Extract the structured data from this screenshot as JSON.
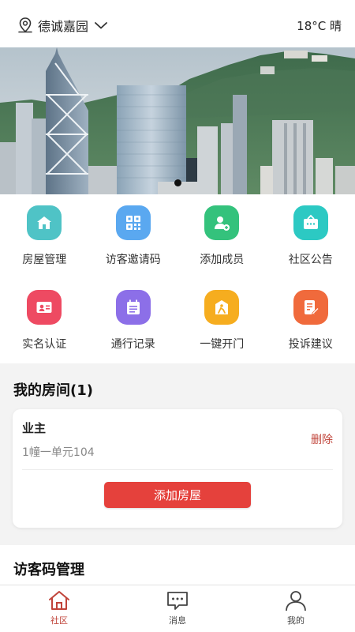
{
  "header": {
    "location": "德诚嘉园",
    "weather": "18°C 晴"
  },
  "banner": {
    "slides": 1,
    "active_slide": 1
  },
  "quick_actions": [
    {
      "label": "房屋管理",
      "icon": "house-icon",
      "color": "#4fc3c6"
    },
    {
      "label": "访客邀请码",
      "icon": "qr-code-icon",
      "color": "#5aa8f0"
    },
    {
      "label": "添加成员",
      "icon": "add-member-icon",
      "color": "#34c27c"
    },
    {
      "label": "社区公告",
      "icon": "notice-icon",
      "color": "#2cc9c3"
    },
    {
      "label": "实名认证",
      "icon": "id-card-icon",
      "color": "#ee4a62"
    },
    {
      "label": "通行记录",
      "icon": "calendar-list-icon",
      "color": "#8c6fe8"
    },
    {
      "label": "一键开门",
      "icon": "door-open-icon",
      "color": "#f6ad1f"
    },
    {
      "label": "投诉建议",
      "icon": "edit-note-icon",
      "color": "#f06a3c"
    }
  ],
  "my_rooms": {
    "title": "我的房间(1)",
    "room": {
      "role": "业主",
      "address": "1幢一单元104",
      "delete_label": "删除"
    },
    "add_button": "添加房屋"
  },
  "visitor_code": {
    "title": "访客码管理"
  },
  "tabbar": [
    {
      "label": "社区",
      "icon": "home-icon",
      "active": true
    },
    {
      "label": "消息",
      "icon": "message-icon",
      "active": false
    },
    {
      "label": "我的",
      "icon": "user-icon",
      "active": false
    }
  ],
  "colors": {
    "accent": "#e5413c",
    "delete": "#c0443a",
    "tab_active": "#c0443a"
  }
}
